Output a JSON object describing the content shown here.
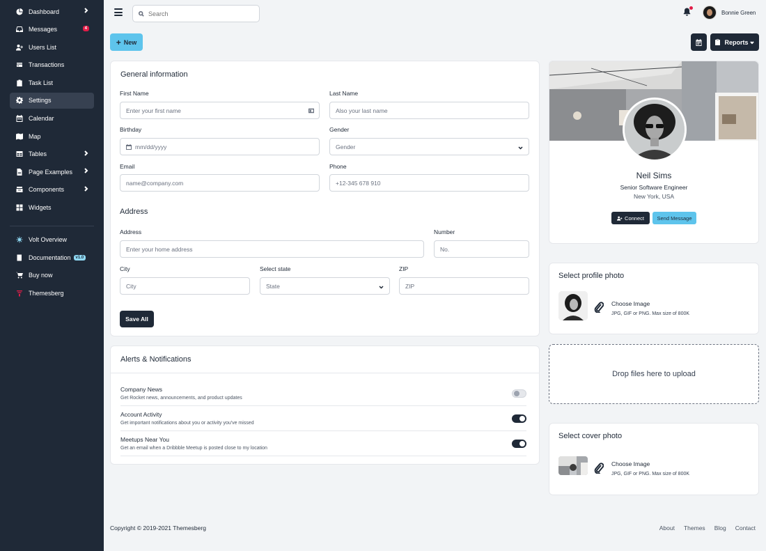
{
  "sidebar": {
    "items": [
      {
        "label": "Dashboard",
        "icon": "pie-chart-icon",
        "chevron": true
      },
      {
        "label": "Messages",
        "icon": "inbox-icon",
        "badge": "4"
      },
      {
        "label": "Users List",
        "icon": "users-icon"
      },
      {
        "label": "Transactions",
        "icon": "credit-card-icon"
      },
      {
        "label": "Task List",
        "icon": "clipboard-icon"
      },
      {
        "label": "Settings",
        "icon": "gear-icon",
        "active": true
      },
      {
        "label": "Calendar",
        "icon": "calendar-icon"
      },
      {
        "label": "Map",
        "icon": "map-icon"
      },
      {
        "label": "Tables",
        "icon": "table-icon",
        "chevron": true
      },
      {
        "label": "Page Examples",
        "icon": "document-icon",
        "chevron": true
      },
      {
        "label": "Components",
        "icon": "inbox-stack-icon",
        "chevron": true
      },
      {
        "label": "Widgets",
        "icon": "grid-icon"
      }
    ],
    "secondary": [
      {
        "label": "Volt Overview",
        "icon": "volt-logo-icon"
      },
      {
        "label": "Documentation",
        "icon": "book-icon",
        "version": "v1.0"
      },
      {
        "label": "Buy now",
        "icon": "cart-icon"
      },
      {
        "label": "Themesberg",
        "icon": "themesberg-logo-icon"
      }
    ]
  },
  "topbar": {
    "search_placeholder": "Search",
    "user_name": "Bonnie Green"
  },
  "actions": {
    "new_label": "New",
    "reports_label": "Reports"
  },
  "general": {
    "title": "General information",
    "first_name_label": "First Name",
    "first_name_placeholder": "Enter your first name",
    "last_name_label": "Last Name",
    "last_name_placeholder": "Also your last name",
    "birthday_label": "Birthday",
    "birthday_placeholder": "mm/dd/yyyy",
    "gender_label": "Gender",
    "gender_value": "Gender",
    "email_label": "Email",
    "email_placeholder": "name@company.com",
    "phone_label": "Phone",
    "phone_placeholder": "+12-345 678 910",
    "address_title": "Address",
    "address_label": "Address",
    "address_placeholder": "Enter your home address",
    "number_label": "Number",
    "number_placeholder": "No.",
    "city_label": "City",
    "city_placeholder": "City",
    "state_label": "Select state",
    "state_value": "State",
    "zip_label": "ZIP",
    "zip_placeholder": "ZIP",
    "save_label": "Save All"
  },
  "alerts": {
    "title": "Alerts & Notifications",
    "rows": [
      {
        "title": "Company News",
        "desc": "Get Rocket news, announcements, and product updates",
        "enabled": false
      },
      {
        "title": "Account Activity",
        "desc": "Get important notifications about you or activity you've missed",
        "enabled": true
      },
      {
        "title": "Meetups Near You",
        "desc": "Get an email when a Dribbble Meetup is posted close to my location",
        "enabled": true
      }
    ]
  },
  "profile": {
    "name": "Neil Sims",
    "role": "Senior Software Engineer",
    "location": "New York, USA",
    "connect_label": "Connect",
    "send_label": "Send Message"
  },
  "profile_photo": {
    "title": "Select profile photo",
    "choose_label": "Choose Image",
    "hint": "JPG, GIF or PNG. Max size of 800K"
  },
  "dropzone": {
    "label": "Drop files here to upload"
  },
  "cover_photo": {
    "title": "Select cover photo",
    "choose_label": "Choose Image",
    "hint": "JPG, GIF or PNG. Max size of 800K"
  },
  "footer": {
    "copyright": "Copyright © 2019-2021 Themesberg",
    "links": [
      "About",
      "Themes",
      "Blog",
      "Contact"
    ]
  },
  "colors": {
    "sidebar_bg": "#1f2937",
    "accent": "#5ec4ec",
    "badge": "#e11d48",
    "page_bg": "#f2f4f6"
  }
}
